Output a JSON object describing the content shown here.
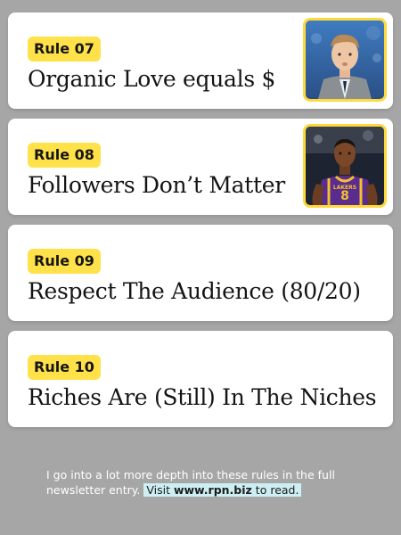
{
  "rules": [
    {
      "number": "Rule 07",
      "title": "Organic Love equals $",
      "image": "man-in-suit-photo"
    },
    {
      "number": "Rule 08",
      "title": "Followers Don’t Matter",
      "image": "basketball-player-photo"
    },
    {
      "number": "Rule 09",
      "title": "Respect The Audience (80/20)"
    },
    {
      "number": "Rule 10",
      "title": "Riches Are (Still) In The Niches"
    }
  ],
  "footer": {
    "text": "I go into a lot more depth into these rules in the full newsletter entry.",
    "cta_prefix": "Visit ",
    "cta_link": "www.rpn.biz",
    "cta_suffix": " to read."
  },
  "colors": {
    "background": "#a6a6a6",
    "card": "#ffffff",
    "badge": "#ffe14a",
    "cta_highlight": "#cdeff3"
  }
}
